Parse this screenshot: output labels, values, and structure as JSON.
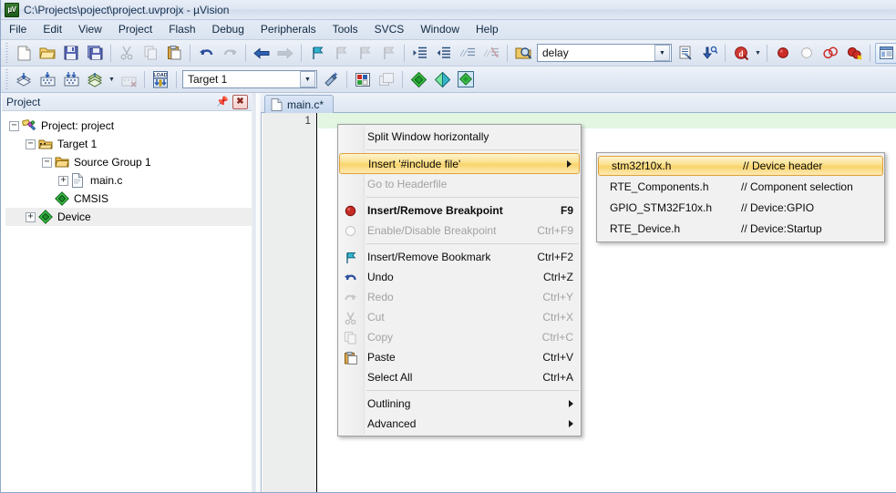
{
  "window": {
    "title": "C:\\Projects\\poject\\project.uvprojx - µVision",
    "app_icon": "uvision-logo-icon"
  },
  "menubar": {
    "items": [
      {
        "label": "File"
      },
      {
        "label": "Edit"
      },
      {
        "label": "View"
      },
      {
        "label": "Project"
      },
      {
        "label": "Flash"
      },
      {
        "label": "Debug"
      },
      {
        "label": "Peripherals"
      },
      {
        "label": "Tools"
      },
      {
        "label": "SVCS"
      },
      {
        "label": "Window"
      },
      {
        "label": "Help"
      }
    ]
  },
  "toolbar_file": {
    "buttons": [
      {
        "name": "new-file-icon"
      },
      {
        "name": "open-file-icon"
      },
      {
        "name": "save-icon"
      },
      {
        "name": "save-all-icon"
      },
      {
        "name": "cut-icon"
      },
      {
        "name": "copy-icon"
      },
      {
        "name": "paste-icon"
      },
      {
        "name": "undo-icon"
      },
      {
        "name": "redo-icon"
      },
      {
        "name": "navigate-back-icon"
      },
      {
        "name": "navigate-forward-icon"
      },
      {
        "name": "bookmark-toggle-icon"
      },
      {
        "name": "bookmark-prev-icon"
      },
      {
        "name": "bookmark-next-icon"
      },
      {
        "name": "bookmark-clear-icon"
      },
      {
        "name": "indent-icon"
      },
      {
        "name": "outdent-icon"
      },
      {
        "name": "comment-icon"
      },
      {
        "name": "uncomment-icon"
      }
    ],
    "find_combo": {
      "value": "delay",
      "placeholder": "Find"
    },
    "open_find_icon": "find-in-files-icon",
    "config_icon": "configuration-wizard-icon",
    "goto_icon": "jump-to-definition-icon",
    "debug_icon": "start-debug-session-icon",
    "breakpoint_icons": [
      "insert-breakpoint-icon",
      "disable-breakpoint-icon",
      "kill-all-breakpoints-icon",
      "disable-all-breakpoints-icon"
    ],
    "window_icon": "manage-windows-icon",
    "customize_icon": "customize-tools-icon"
  },
  "toolbar_build": {
    "buttons": [
      {
        "name": "translate-file-icon"
      },
      {
        "name": "build-target-icon"
      },
      {
        "name": "rebuild-all-icon"
      },
      {
        "name": "batch-build-icon"
      },
      {
        "name": "stop-build-icon"
      },
      {
        "name": "download-to-flash-icon"
      }
    ],
    "target_combo": {
      "value": "Target 1"
    },
    "target_options": [
      "Target 1"
    ],
    "select_target_icon": "select-target-icon",
    "options_icon": "options-for-target-icon",
    "manage_project_icon": "manage-project-items-icon",
    "pack_icons": [
      "manage-run-time-environment-icon",
      "pack-installer-icon",
      "select-software-packs-icon"
    ]
  },
  "project_panel": {
    "title": "Project",
    "pin_icon": "pin-icon",
    "close_icon": "close-icon",
    "tree": [
      {
        "label": "Project: project",
        "icon": "project-icon",
        "expander": "-",
        "indent": 0,
        "selected": false
      },
      {
        "label": "Target 1",
        "icon": "target-icon",
        "expander": "-",
        "indent": 1,
        "selected": false
      },
      {
        "label": "Source Group 1",
        "icon": "folder-icon",
        "expander": "-",
        "indent": 2,
        "selected": false
      },
      {
        "label": "main.c",
        "icon": "c-file-icon",
        "expander": "+",
        "indent": 3,
        "selected": false
      },
      {
        "label": "CMSIS",
        "icon": "component-icon",
        "expander": "",
        "indent": 2,
        "selected": false
      },
      {
        "label": "Device",
        "icon": "component-icon",
        "expander": "+",
        "indent": 2,
        "selected": true
      }
    ]
  },
  "editor": {
    "tabs": [
      {
        "label": "main.c*",
        "icon": "source-file-icon",
        "active": true
      }
    ],
    "line_numbers": [
      "1"
    ],
    "current_line_highlight_color": "#e2f6e2"
  },
  "context_menu": {
    "items": [
      {
        "label": "Split Window horizontally",
        "shortcut": "",
        "icon": "",
        "disabled": false,
        "submenu": false,
        "highlight": false,
        "bold": false
      },
      {
        "separator": true
      },
      {
        "label": "Insert '#include file'",
        "shortcut": "",
        "icon": "",
        "disabled": false,
        "submenu": true,
        "highlight": true,
        "bold": false
      },
      {
        "label": "Go to Headerfile",
        "shortcut": "",
        "icon": "",
        "disabled": true,
        "submenu": false,
        "highlight": false,
        "bold": false
      },
      {
        "separator": true
      },
      {
        "label": "Insert/Remove Breakpoint",
        "shortcut": "F9",
        "icon": "breakpoint-red-dot-icon",
        "disabled": false,
        "submenu": false,
        "highlight": false,
        "bold": true
      },
      {
        "label": "Enable/Disable Breakpoint",
        "shortcut": "Ctrl+F9",
        "icon": "breakpoint-hollow-circle-icon",
        "disabled": true,
        "submenu": false,
        "highlight": false,
        "bold": false
      },
      {
        "separator": true
      },
      {
        "label": "Insert/Remove Bookmark",
        "shortcut": "Ctrl+F2",
        "icon": "bookmark-flag-icon",
        "disabled": false,
        "submenu": false,
        "highlight": false,
        "bold": false
      },
      {
        "label": "Undo",
        "shortcut": "Ctrl+Z",
        "icon": "undo-arrow-icon",
        "disabled": false,
        "submenu": false,
        "highlight": false,
        "bold": false
      },
      {
        "label": "Redo",
        "shortcut": "Ctrl+Y",
        "icon": "redo-arrow-icon",
        "disabled": true,
        "submenu": false,
        "highlight": false,
        "bold": false
      },
      {
        "label": "Cut",
        "shortcut": "Ctrl+X",
        "icon": "scissors-icon",
        "disabled": true,
        "submenu": false,
        "highlight": false,
        "bold": false
      },
      {
        "label": "Copy",
        "shortcut": "Ctrl+C",
        "icon": "copy-pages-icon",
        "disabled": true,
        "submenu": false,
        "highlight": false,
        "bold": false
      },
      {
        "label": "Paste",
        "shortcut": "Ctrl+V",
        "icon": "clipboard-paste-icon",
        "disabled": false,
        "submenu": false,
        "highlight": false,
        "bold": false
      },
      {
        "label": "Select All",
        "shortcut": "Ctrl+A",
        "icon": "",
        "disabled": false,
        "submenu": false,
        "highlight": false,
        "bold": false
      },
      {
        "separator": true
      },
      {
        "label": "Outlining",
        "shortcut": "",
        "icon": "",
        "disabled": false,
        "submenu": true,
        "highlight": false,
        "bold": false
      },
      {
        "label": "Advanced",
        "shortcut": "",
        "icon": "",
        "disabled": false,
        "submenu": true,
        "highlight": false,
        "bold": false
      }
    ]
  },
  "include_submenu": {
    "items": [
      {
        "name": "stm32f10x.h",
        "comment": "// Device header",
        "highlight": true
      },
      {
        "name": "RTE_Components.h",
        "comment": "// Component selection",
        "highlight": false
      },
      {
        "name": "GPIO_STM32F10x.h",
        "comment": "// Device:GPIO",
        "highlight": false
      },
      {
        "name": "RTE_Device.h",
        "comment": "// Device:Startup",
        "highlight": false
      }
    ]
  },
  "colors": {
    "menu_highlight": "#f9d46a",
    "menu_highlight_border": "#e0a03a",
    "titlebar_text": "#14304f",
    "current_line": "#e2f6e2",
    "tree_selection": "#eeeeee"
  }
}
